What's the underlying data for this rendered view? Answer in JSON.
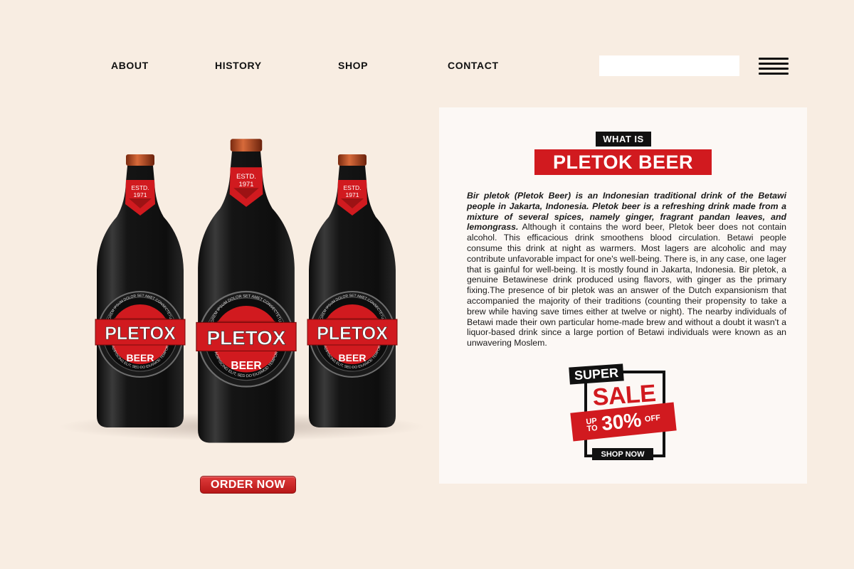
{
  "nav": {
    "items": [
      {
        "label": "ABOUT"
      },
      {
        "label": "HISTORY"
      },
      {
        "label": "SHOP"
      },
      {
        "label": "CONTACT"
      }
    ],
    "search_placeholder": "",
    "search_icon": "search-icon",
    "menu_icon": "hamburger-icon"
  },
  "product": {
    "brand": "PLETOX",
    "type": "BEER",
    "estd_line1": "ESTD.",
    "estd_line2": "1971",
    "ring_top": "LOREM IPSUM DOLOR SET AMET CONSECTETUR",
    "ring_bottom": "ADIPISCING ELIT, SED DO EIUSMOD TEMPOR",
    "order_label": "ORDER NOW"
  },
  "info": {
    "kicker": "WHAT IS",
    "title": "PLETOK BEER",
    "intro_italic": "Bir pletok (Pletok Beer) is an Indonesian traditional drink of the Betawi people in Jakarta, Indonesia. Pletok beer is a refreshing drink made from a mixture of several spices, namely ginger, fragrant pandan leaves, and lemongrass.",
    "body": " Although it contains the word beer, Pletok beer does not contain alcohol. This efficacious drink smoothens blood circulation. Betawi people consume this drink at night as warmers. Most lagers are alcoholic and may contribute unfavorable impact for one's well-being. There is, in any case, one lager that is gainful for well-being. It is mostly found in Jakarta, Indonesia. Bir pletok, a genuine Betawinese drink produced using flavors, with ginger as the primary fixing.The presence of bir pletok was an answer of the Dutch expansionism that accompanied the majority of their traditions (counting their propensity to take a brew while having save times either at twelve or night). The nearby individuals of Betawi made their own particular home-made brew and without a doubt it wasn't a liquor-based drink since a large portion of Betawi individuals were known as an unwavering Moslem."
  },
  "sale": {
    "super": "SUPER",
    "word": "SALE",
    "up": "UP",
    "to": "TO",
    "percent": "30%",
    "off": "OFF",
    "shop_now": "SHOP NOW"
  },
  "colors": {
    "background": "#f8ede2",
    "panel": "#fcf8f5",
    "accent_red": "#d11a1f",
    "ink": "#111111"
  }
}
